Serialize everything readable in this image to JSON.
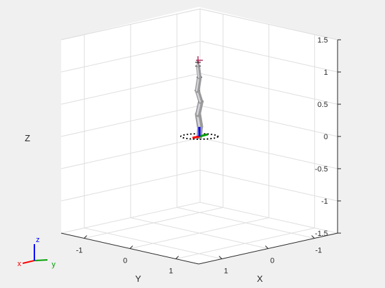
{
  "chart_data": {
    "type": "3d-plot",
    "title": "",
    "xlabel": "X",
    "ylabel": "Y",
    "zlabel": "Z",
    "xlim": [
      -1.5,
      1.5
    ],
    "ylim": [
      -1.5,
      1.5
    ],
    "zlim": [
      -1.5,
      1.5
    ],
    "xticks": [
      "-1",
      "0",
      "1"
    ],
    "yticks": [
      "-1",
      "0",
      "1"
    ],
    "zticks": [
      "-1.5",
      "-1",
      "-0.5",
      "0",
      "0.5",
      "1",
      "1.5"
    ],
    "grid": true,
    "robot": {
      "base": [
        0,
        0,
        0
      ],
      "top": [
        0,
        0,
        1.15
      ],
      "link_color": "#9a9a9a",
      "base_ring_color": "#000000"
    },
    "base_frame_axes": [
      {
        "axis": "x",
        "color": "#ff0000"
      },
      {
        "axis": "y",
        "color": "#00a000"
      },
      {
        "axis": "z",
        "color": "#0000ff"
      }
    ],
    "triad": [
      {
        "label": "x",
        "color": "#ff0000"
      },
      {
        "label": "y",
        "color": "#00a000"
      },
      {
        "label": "z",
        "color": "#0000ff"
      }
    ]
  }
}
